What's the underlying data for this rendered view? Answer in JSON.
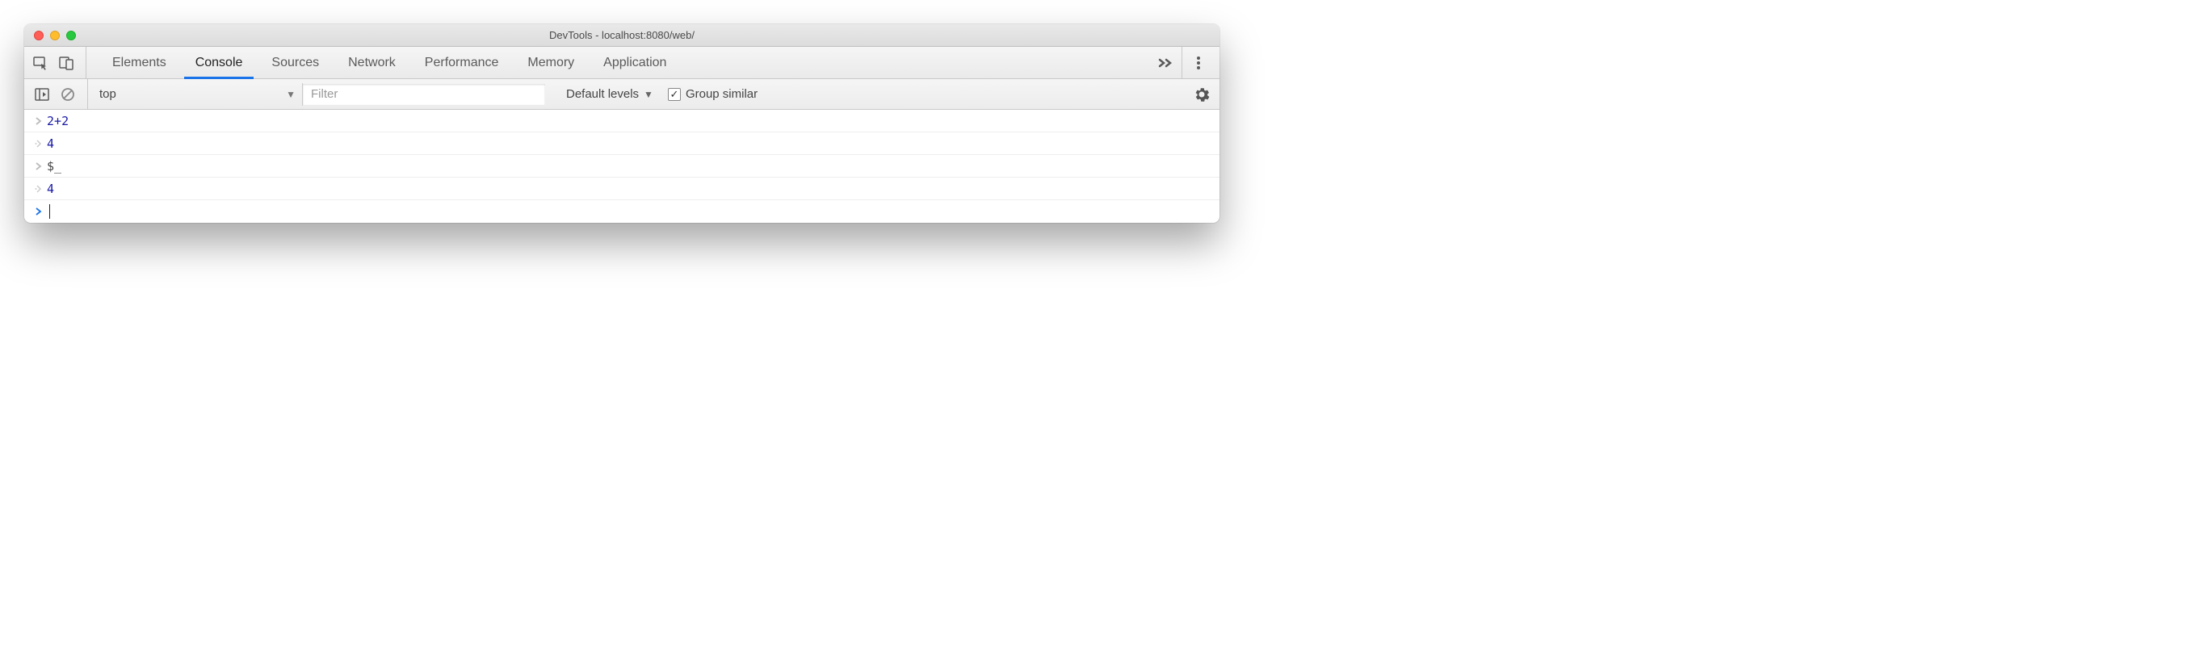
{
  "window": {
    "title": "DevTools - localhost:8080/web/"
  },
  "tabs": {
    "items": [
      "Elements",
      "Console",
      "Sources",
      "Network",
      "Performance",
      "Memory",
      "Application"
    ],
    "active_index": 1
  },
  "toolbar": {
    "context": "top",
    "filter_placeholder": "Filter",
    "levels_label": "Default levels",
    "group_label": "Group similar",
    "group_checked": true
  },
  "console": {
    "lines": [
      {
        "type": "input",
        "tokens": [
          {
            "t": "num",
            "v": "2"
          },
          {
            "t": "op",
            "v": "+"
          },
          {
            "t": "num",
            "v": "2"
          }
        ]
      },
      {
        "type": "output",
        "value": "4"
      },
      {
        "type": "input",
        "tokens": [
          {
            "t": "plain",
            "v": "$_"
          }
        ]
      },
      {
        "type": "output",
        "value": "4"
      },
      {
        "type": "prompt"
      }
    ]
  }
}
